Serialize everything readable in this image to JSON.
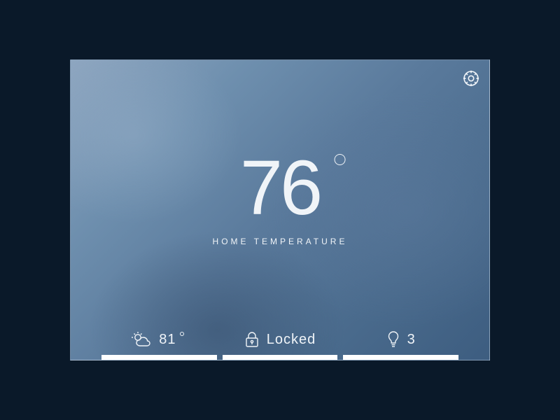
{
  "main": {
    "temperature_value": "76",
    "temperature_label": "HOME TEMPERATURE"
  },
  "footer": {
    "weather_temp": "81",
    "lock_status": "Locked",
    "lights_on_count": "3"
  }
}
